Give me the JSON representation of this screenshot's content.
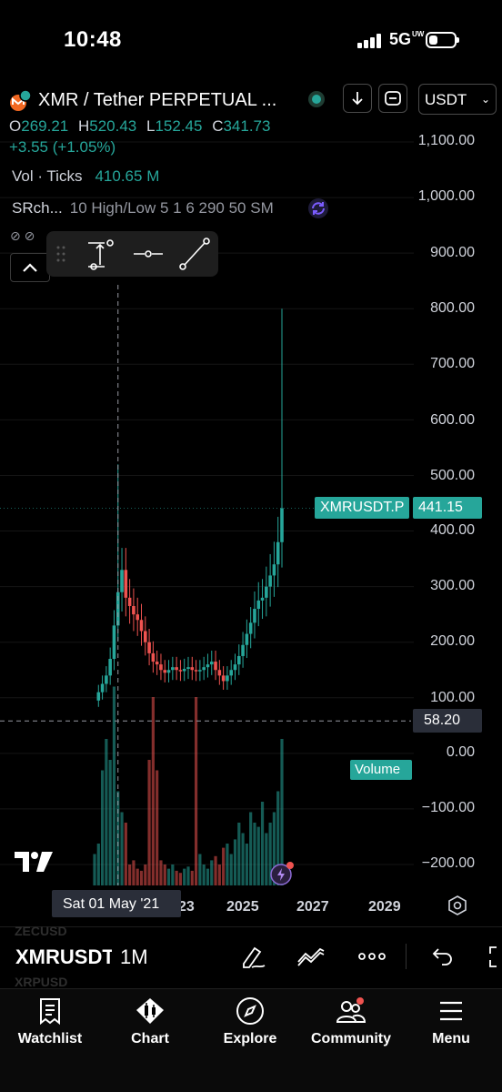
{
  "status": {
    "time": "10:48",
    "network": "5G",
    "network_sub": "UW",
    "battery_fraction": 0.35
  },
  "header": {
    "symbol_title": "XMR / Tether PERPETUAL ...",
    "currency": "USDT"
  },
  "ohlc": {
    "o_key": "O",
    "o": "269.21",
    "h_key": "H",
    "h": "520.43",
    "l_key": "L",
    "l": "152.45",
    "c_key": "C",
    "c": "341.73",
    "change": "+3.55 (+1.05%)"
  },
  "indicators": {
    "volume_label": "Vol · Ticks",
    "volume_value": "410.65 M",
    "sr_name": "SRch...",
    "sr_params": "10 High/Low 5 1 6 290 50 SM",
    "eye_icons": "⊘ ⊘"
  },
  "y_ticks": [
    "1,100.00",
    "1,000.00",
    "900.00",
    "800.00",
    "700.00",
    "600.00",
    "500.00",
    "400.00",
    "300.00",
    "200.00",
    "100.00",
    "0.00",
    "−100.00",
    "−200.00"
  ],
  "labels": {
    "last_price": "441.15",
    "symbol_tag": "XMRUSDT.P",
    "crosshair_price": "58.20",
    "volume_tag": "Volume",
    "crosshair_date": "Sat 01 May '21"
  },
  "x_axis": [
    "23",
    "2025",
    "2027",
    "2029"
  ],
  "symbol_bar": {
    "ghost_top": "ZECUSD",
    "symbol": "XMRUSDT.P",
    "ghost_bottom": "XRPUSD",
    "interval": "1M"
  },
  "nav": {
    "watchlist": "Watchlist",
    "chart": "Chart",
    "explore": "Explore",
    "community": "Community",
    "menu": "Menu"
  },
  "colors": {
    "up": "#26a69a",
    "down": "#ef5350",
    "background": "#000000",
    "panel": "#1e1e1e"
  },
  "chart_data": {
    "type": "candlestick",
    "interval": "1M",
    "y_range": [
      -200,
      1100
    ],
    "x_ticks": [
      "23",
      "2025",
      "2027",
      "2029"
    ],
    "price_path": [
      95,
      110,
      125,
      140,
      170,
      230,
      290,
      330,
      280,
      265,
      250,
      240,
      220,
      200,
      180,
      165,
      160,
      150,
      145,
      150,
      155,
      150,
      148,
      152,
      155,
      150,
      148,
      150,
      155,
      160,
      165,
      150,
      140,
      130,
      140,
      150,
      160,
      175,
      195,
      215,
      235,
      260,
      275,
      280,
      300,
      320,
      340,
      380,
      441
    ],
    "wick_extremes": {
      "high_spike": 800,
      "early_high": 520
    },
    "volume_path": [
      0.15,
      0.2,
      0.55,
      0.7,
      0.6,
      0.95,
      0.45,
      0.35,
      0.3,
      0.1,
      0.12,
      0.08,
      0.07,
      0.1,
      0.6,
      0.9,
      0.55,
      0.12,
      0.1,
      0.08,
      0.1,
      0.07,
      0.06,
      0.08,
      0.09,
      0.07,
      0.9,
      0.15,
      0.1,
      0.08,
      0.12,
      0.14,
      0.1,
      0.18,
      0.2,
      0.15,
      0.22,
      0.3,
      0.25,
      0.2,
      0.35,
      0.3,
      0.28,
      0.4,
      0.25,
      0.3,
      0.35,
      0.45,
      0.7
    ]
  }
}
